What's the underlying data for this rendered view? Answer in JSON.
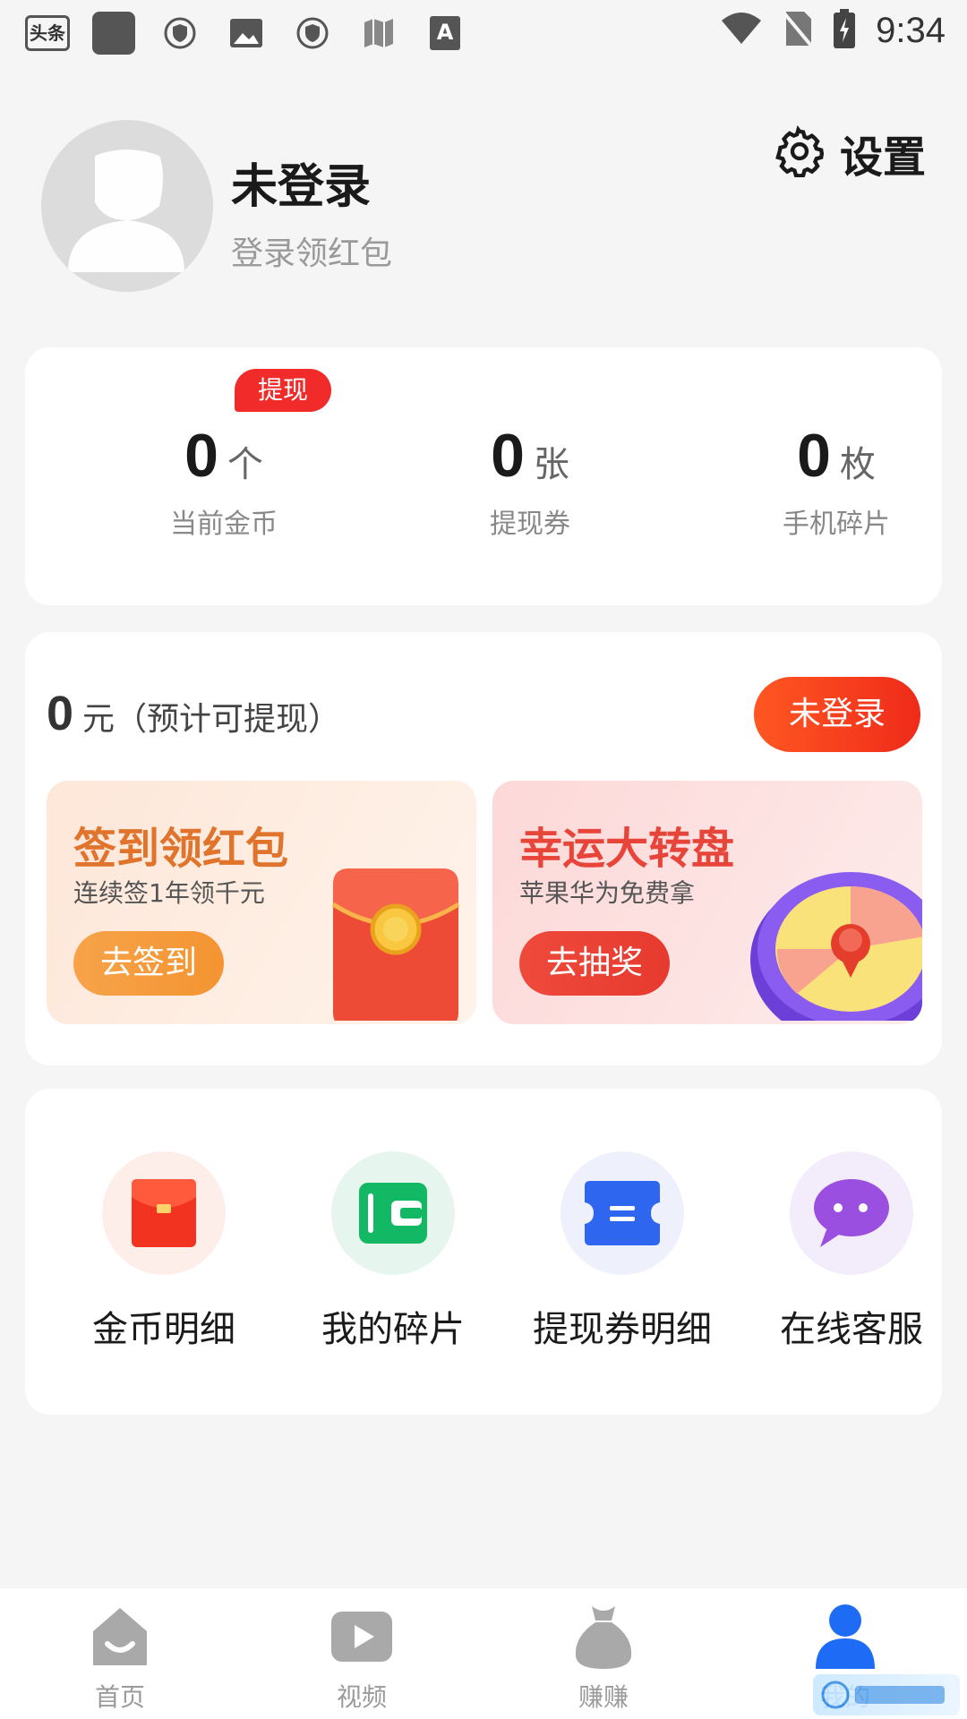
{
  "status_bar": {
    "left_icons": [
      "toutiao-icon",
      "app-square-icon",
      "shield-icon",
      "gallery-icon",
      "shield-icon",
      "map-icon",
      "font-icon"
    ],
    "toutiao_text": "头条",
    "time": "9:34"
  },
  "profile": {
    "name": "未登录",
    "hint": "登录领红包",
    "settings_label": "设置"
  },
  "stats": {
    "badge": "提现",
    "items": [
      {
        "value": "0",
        "unit": "个",
        "label": "当前金币"
      },
      {
        "value": "0",
        "unit": "张",
        "label": "提现券"
      },
      {
        "value": "0",
        "unit": "枚",
        "label": "手机碎片"
      }
    ]
  },
  "earnings": {
    "amount": "0",
    "text": "元（预计可提现）",
    "login_button": "未登录"
  },
  "promos": [
    {
      "title": "签到领红包",
      "subtitle": "连续签1年领千元",
      "button": "去签到"
    },
    {
      "title": "幸运大转盘",
      "subtitle": "苹果华为免费拿",
      "button": "去抽奖"
    }
  ],
  "features": [
    {
      "label": "金币明细",
      "icon": "red-envelope-icon"
    },
    {
      "label": "我的碎片",
      "icon": "wallet-icon"
    },
    {
      "label": "提现券明细",
      "icon": "ticket-icon"
    },
    {
      "label": "在线客服",
      "icon": "chat-icon"
    }
  ],
  "bottom_nav": [
    {
      "label": "首页",
      "icon": "home-icon"
    },
    {
      "label": "视频",
      "icon": "video-icon"
    },
    {
      "label": "赚赚",
      "icon": "money-bag-icon"
    },
    {
      "label": "我的",
      "icon": "user-icon",
      "active": true
    }
  ],
  "colors": {
    "accent_red": "#f12a2a",
    "nav_active": "#1e6cf5"
  }
}
